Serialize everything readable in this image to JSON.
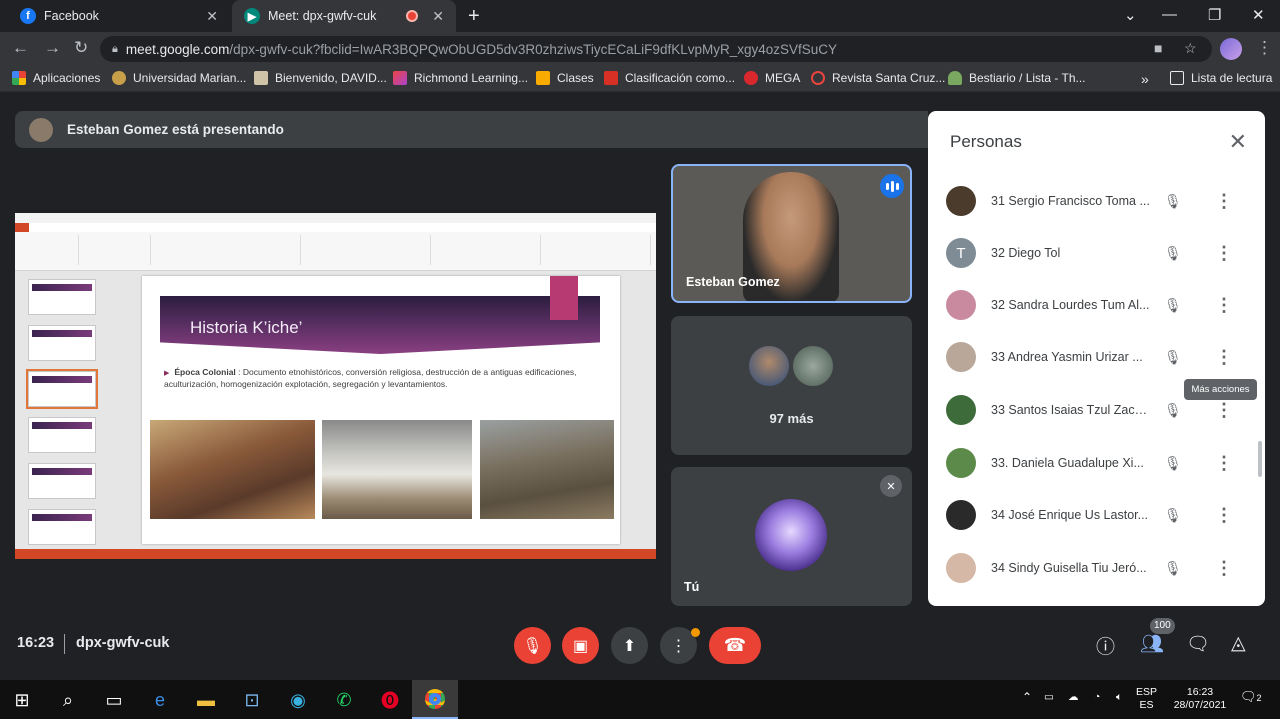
{
  "browser": {
    "tabs": [
      {
        "title": "Facebook",
        "icon": "facebook-icon"
      },
      {
        "title": "Meet: dpx-gwfv-cuk",
        "icon": "meet-icon"
      }
    ],
    "url_host": "meet.google.com",
    "url_path": "/dpx-gwfv-cuk?fbclid=IwAR3BQPQwObUGD5dv3R0zhziwsTiycECaLiF9dfKLvpMyR_xgy4ozSVfSuCY",
    "bookmarks": [
      "Aplicaciones",
      "Universidad Marian...",
      "Bienvenido, DAVID...",
      "Richmond Learning...",
      "Clases",
      "Clasificación como...",
      "MEGA",
      "Revista Santa Cruz...",
      "Bestiario / Lista - Th..."
    ],
    "reading_list": "Lista de lectura"
  },
  "meet": {
    "presenting_banner": "Esteban Gomez está presentando",
    "slide": {
      "title": "Historia K’iche’",
      "bullet_label": "Época Colonial",
      "bullet_text": ": Documento etnohistóricos, conversión religiosa, destrucción de a antiguas edificaciones, aculturización, homogenización explotación, segregación y levantamientos."
    },
    "tiles": {
      "presenter_name": "Esteban Gomez",
      "more_count": "97 más",
      "self_label": "Tú"
    },
    "time": "16:23",
    "meeting_code": "dpx-gwfv-cuk",
    "participant_count": "100"
  },
  "people_panel": {
    "title": "Personas",
    "participants": [
      {
        "name": "31 Sergio Francisco Toma ...",
        "avatar_color": "#4a3b2c"
      },
      {
        "name": "32 Diego Tol",
        "avatar_color": "#7f8c95",
        "initial": "T"
      },
      {
        "name": "32 Sandra Lourdes Tum Al...",
        "avatar_color": "#c98aa0"
      },
      {
        "name": "33 Andrea Yasmin Urizar ...",
        "avatar_color": "#b9a89a"
      },
      {
        "name": "33 Santos Isaias Tzul Zaca...",
        "avatar_color": "#3d6b3a"
      },
      {
        "name": "33. Daniela Guadalupe Xi...",
        "avatar_color": "#5c8a4a"
      },
      {
        "name": "34 José Enrique Us Lastor...",
        "avatar_color": "#2a2a2a"
      },
      {
        "name": "34 Sindy Guisella Tiu Jeró...",
        "avatar_color": "#d6b8a6"
      }
    ],
    "tooltip": "Más acciones"
  },
  "taskbar": {
    "language_top": "ESP",
    "language_bottom": "ES",
    "time": "16:23",
    "date": "28/07/2021",
    "notifications": "2"
  }
}
